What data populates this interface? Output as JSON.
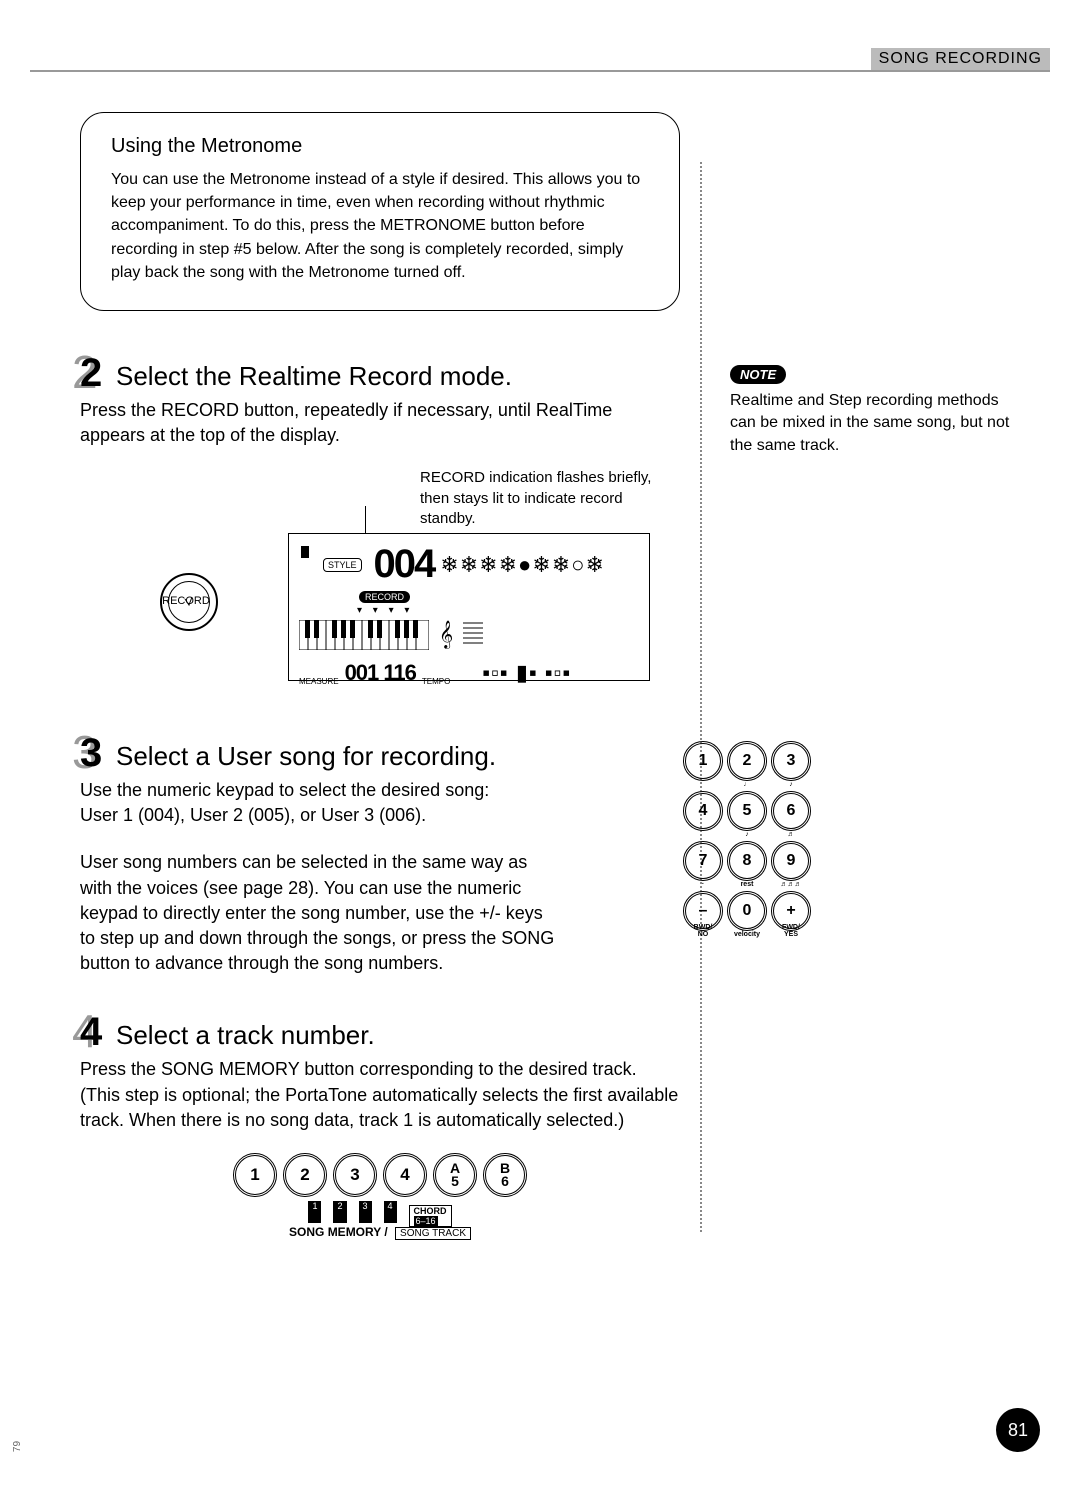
{
  "header": {
    "section": "SONG RECORDING"
  },
  "metronome": {
    "title": "Using the Metronome",
    "body": "You can use the Metronome instead of a style if desired.  This allows you to keep your performance  in time,  even when recording without rhythmic accompaniment.  To do this, press the METRONOME button before recording in step #5 below.  After the song is completely recorded, simply play back the song with the Metronome turned off."
  },
  "step2": {
    "num": "2",
    "heading": "Select the Realtime Record mode.",
    "body": "Press the RECORD button, repeatedly if necessary, until  RealTime  appears at the top of the display.",
    "caption": "RECORD indication flashes briefly, then stays lit to indicate record standby.",
    "button_label": "RECORD",
    "lcd": {
      "style_badge": "STYLE",
      "big_number": "004",
      "record_badge": "RECORD",
      "arrows": "▾ ▾ ▾ ▾",
      "icons": "❄❄❄❄●❄❄○❄",
      "measure_label": "MEASURE",
      "measure_value": "001  116",
      "tempo_label": "TEMPO",
      "segments": "▪▫▪  ▮▪  ▪▫▪"
    }
  },
  "step3": {
    "num": "3",
    "heading": "Select a User song for recording.",
    "body1": "Use the numeric keypad to select the desired song: User 1 (004), User 2 (005), or User 3 (006).",
    "body2": "User song numbers can be selected in the same way as with the voices (see page 28).  You can use the numeric keypad to directly enter the song number, use the +/- keys to step up and down through the songs, or press the SONG button to advance through the song numbers.",
    "keypad": {
      "keys": [
        "1",
        "2",
        "3",
        "4",
        "5",
        "6",
        "7",
        "8",
        "9",
        "–",
        "0",
        "+"
      ],
      "subs": [
        "",
        "♩",
        "♪",
        "",
        "♪",
        "♬",
        "·",
        "rest",
        "♬♬♬",
        "BWD/\nNO",
        "velocity",
        "FWD/\nYES"
      ]
    }
  },
  "step4": {
    "num": "4",
    "heading": "Select a track number.",
    "body": "Press the SONG MEMORY button corresponding to the desired track.  (This step is optional; the PortaTone automatically selects the first available track.  When there is no song data, track 1 is automatically selected.)",
    "song_memory": {
      "buttons": [
        "1",
        "2",
        "3",
        "4"
      ],
      "split": [
        {
          "top": "A",
          "bottom": "5"
        },
        {
          "top": "B",
          "bottom": "6"
        }
      ],
      "under_labels": [
        "1",
        "2",
        "3",
        "4"
      ],
      "title": "SONG MEMORY /",
      "songtrack": "SONG TRACK",
      "chord": "CHORD",
      "chord_range": "6–16"
    }
  },
  "note": {
    "badge": "NOTE",
    "body": "Realtime and Step recording methods can be mixed in the same song, but not the same track."
  },
  "page_number": "81",
  "side_marker": "79"
}
